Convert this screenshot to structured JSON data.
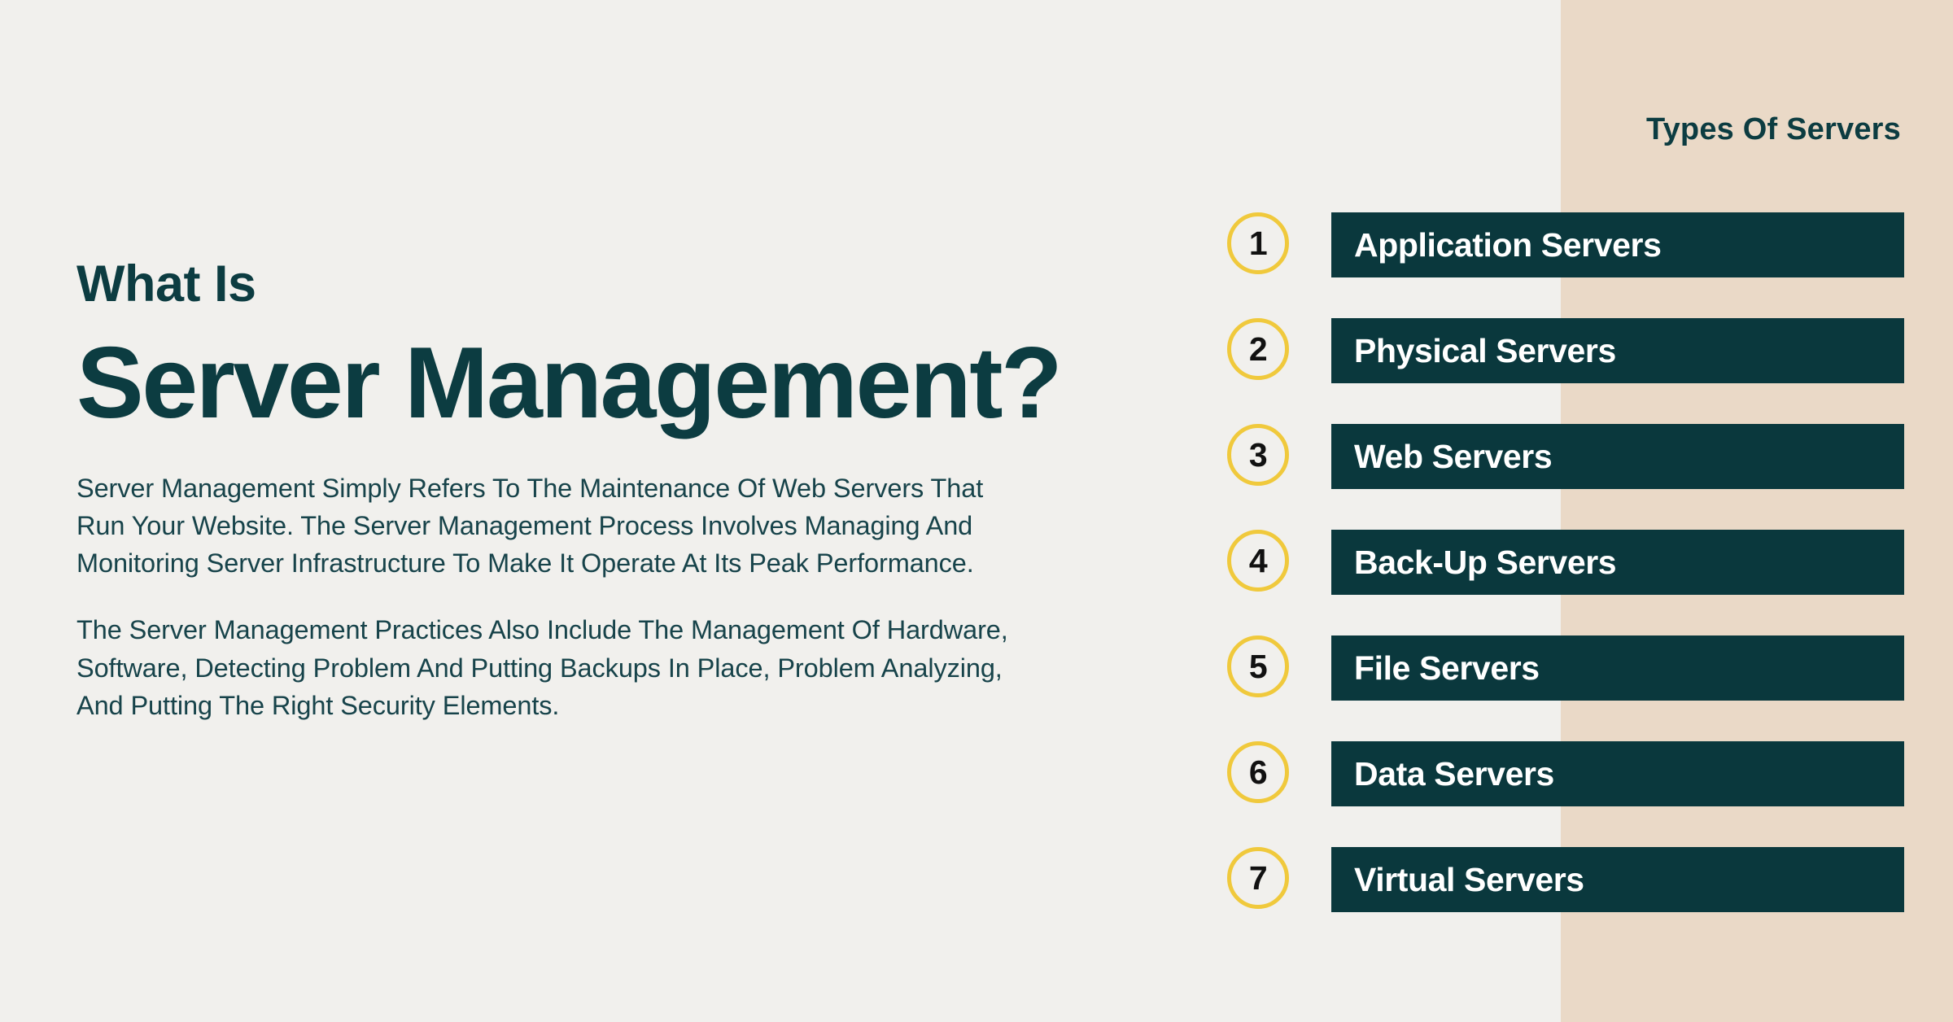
{
  "theme": {
    "background": "#f1f0ed",
    "panel_background": "#ead9c7",
    "dark_teal": "#0a383d",
    "gold": "#f0c93c",
    "text_dark": "#0c3c41",
    "bar_text": "#ffffff",
    "number_text": "#111111"
  },
  "article": {
    "eyebrow": "What Is",
    "title": "Server Management?",
    "paragraphs": [
      "Server Management Simply Refers To The Maintenance Of Web Servers That Run Your Website. The Server Management Process Involves Managing And Monitoring Server Infrastructure To Make It Operate At Its Peak Performance.",
      "The Server Management Practices Also Include The Management Of Hardware, Software, Detecting Problem And Putting Backups In Place, Problem Analyzing, And Putting The Right Security Elements."
    ]
  },
  "panel": {
    "heading": "Types Of Servers",
    "items": [
      {
        "number": "1",
        "label": "Application Servers"
      },
      {
        "number": "2",
        "label": "Physical Servers"
      },
      {
        "number": "3",
        "label": "Web Servers"
      },
      {
        "number": "4",
        "label": "Back-Up Servers"
      },
      {
        "number": "5",
        "label": "File Servers"
      },
      {
        "number": "6",
        "label": "Data Servers"
      },
      {
        "number": "7",
        "label": "Virtual Servers"
      }
    ]
  }
}
